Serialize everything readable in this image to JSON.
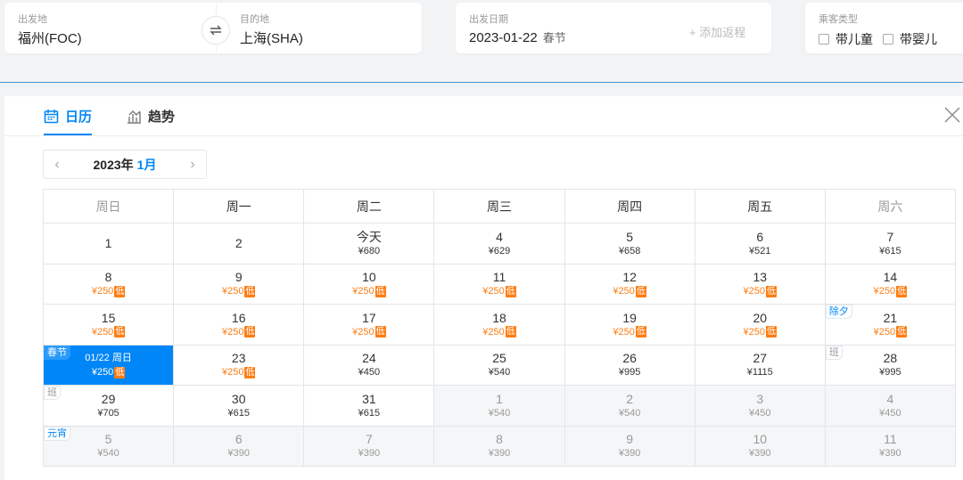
{
  "search": {
    "origin_label": "出发地",
    "origin_value": "福州(FOC)",
    "dest_label": "目的地",
    "dest_value": "上海(SHA)",
    "date_label": "出发日期",
    "date_value": "2023-01-22",
    "date_holiday": "春节",
    "add_return": "+ 添加返程",
    "pax_label": "乘客类型",
    "child_label": "带儿童",
    "infant_label": "带婴儿"
  },
  "tabs": {
    "calendar": "日历",
    "trend": "趋势"
  },
  "month_nav": {
    "year": "2023年",
    "month": "1月"
  },
  "weekdays": [
    "周日",
    "周一",
    "周二",
    "周三",
    "周四",
    "周五",
    "周六"
  ],
  "colors": {
    "accent": "#0086f6",
    "low": "#ff7d13"
  },
  "low_tag": "低",
  "weeks": [
    [
      {
        "day": "1",
        "price": ""
      },
      {
        "day": "2",
        "price": ""
      },
      {
        "day": "今天",
        "price": "¥680"
      },
      {
        "day": "4",
        "price": "¥629"
      },
      {
        "day": "5",
        "price": "¥658"
      },
      {
        "day": "6",
        "price": "¥521"
      },
      {
        "day": "7",
        "price": "¥615"
      }
    ],
    [
      {
        "day": "8",
        "price": "¥250",
        "low": true
      },
      {
        "day": "9",
        "price": "¥250",
        "low": true
      },
      {
        "day": "10",
        "price": "¥250",
        "low": true
      },
      {
        "day": "11",
        "price": "¥250",
        "low": true
      },
      {
        "day": "12",
        "price": "¥250",
        "low": true
      },
      {
        "day": "13",
        "price": "¥250",
        "low": true
      },
      {
        "day": "14",
        "price": "¥250",
        "low": true
      }
    ],
    [
      {
        "day": "15",
        "price": "¥250",
        "low": true
      },
      {
        "day": "16",
        "price": "¥250",
        "low": true
      },
      {
        "day": "17",
        "price": "¥250",
        "low": true
      },
      {
        "day": "18",
        "price": "¥250",
        "low": true
      },
      {
        "day": "19",
        "price": "¥250",
        "low": true
      },
      {
        "day": "20",
        "price": "¥250",
        "low": true
      },
      {
        "day": "21",
        "price": "¥250",
        "low": true,
        "badge": "除夕"
      }
    ],
    [
      {
        "day": "01/22 周日",
        "price": "¥250",
        "low": true,
        "badge": "春节",
        "selected": true
      },
      {
        "day": "23",
        "price": "¥250",
        "low": true
      },
      {
        "day": "24",
        "price": "¥450"
      },
      {
        "day": "25",
        "price": "¥540"
      },
      {
        "day": "26",
        "price": "¥995"
      },
      {
        "day": "27",
        "price": "¥1115"
      },
      {
        "day": "28",
        "price": "¥995",
        "badge": "班",
        "work": true
      }
    ],
    [
      {
        "day": "29",
        "price": "¥705",
        "badge": "班",
        "work": true
      },
      {
        "day": "30",
        "price": "¥615"
      },
      {
        "day": "31",
        "price": "¥615"
      },
      {
        "day": "1",
        "price": "¥540",
        "next": true
      },
      {
        "day": "2",
        "price": "¥540",
        "next": true
      },
      {
        "day": "3",
        "price": "¥450",
        "next": true
      },
      {
        "day": "4",
        "price": "¥450",
        "next": true
      }
    ],
    [
      {
        "day": "5",
        "price": "¥540",
        "next": true,
        "badge": "元宵"
      },
      {
        "day": "6",
        "price": "¥390",
        "next": true
      },
      {
        "day": "7",
        "price": "¥390",
        "next": true
      },
      {
        "day": "8",
        "price": "¥390",
        "next": true
      },
      {
        "day": "9",
        "price": "¥390",
        "next": true
      },
      {
        "day": "10",
        "price": "¥390",
        "next": true
      },
      {
        "day": "11",
        "price": "¥390",
        "next": true
      }
    ]
  ]
}
